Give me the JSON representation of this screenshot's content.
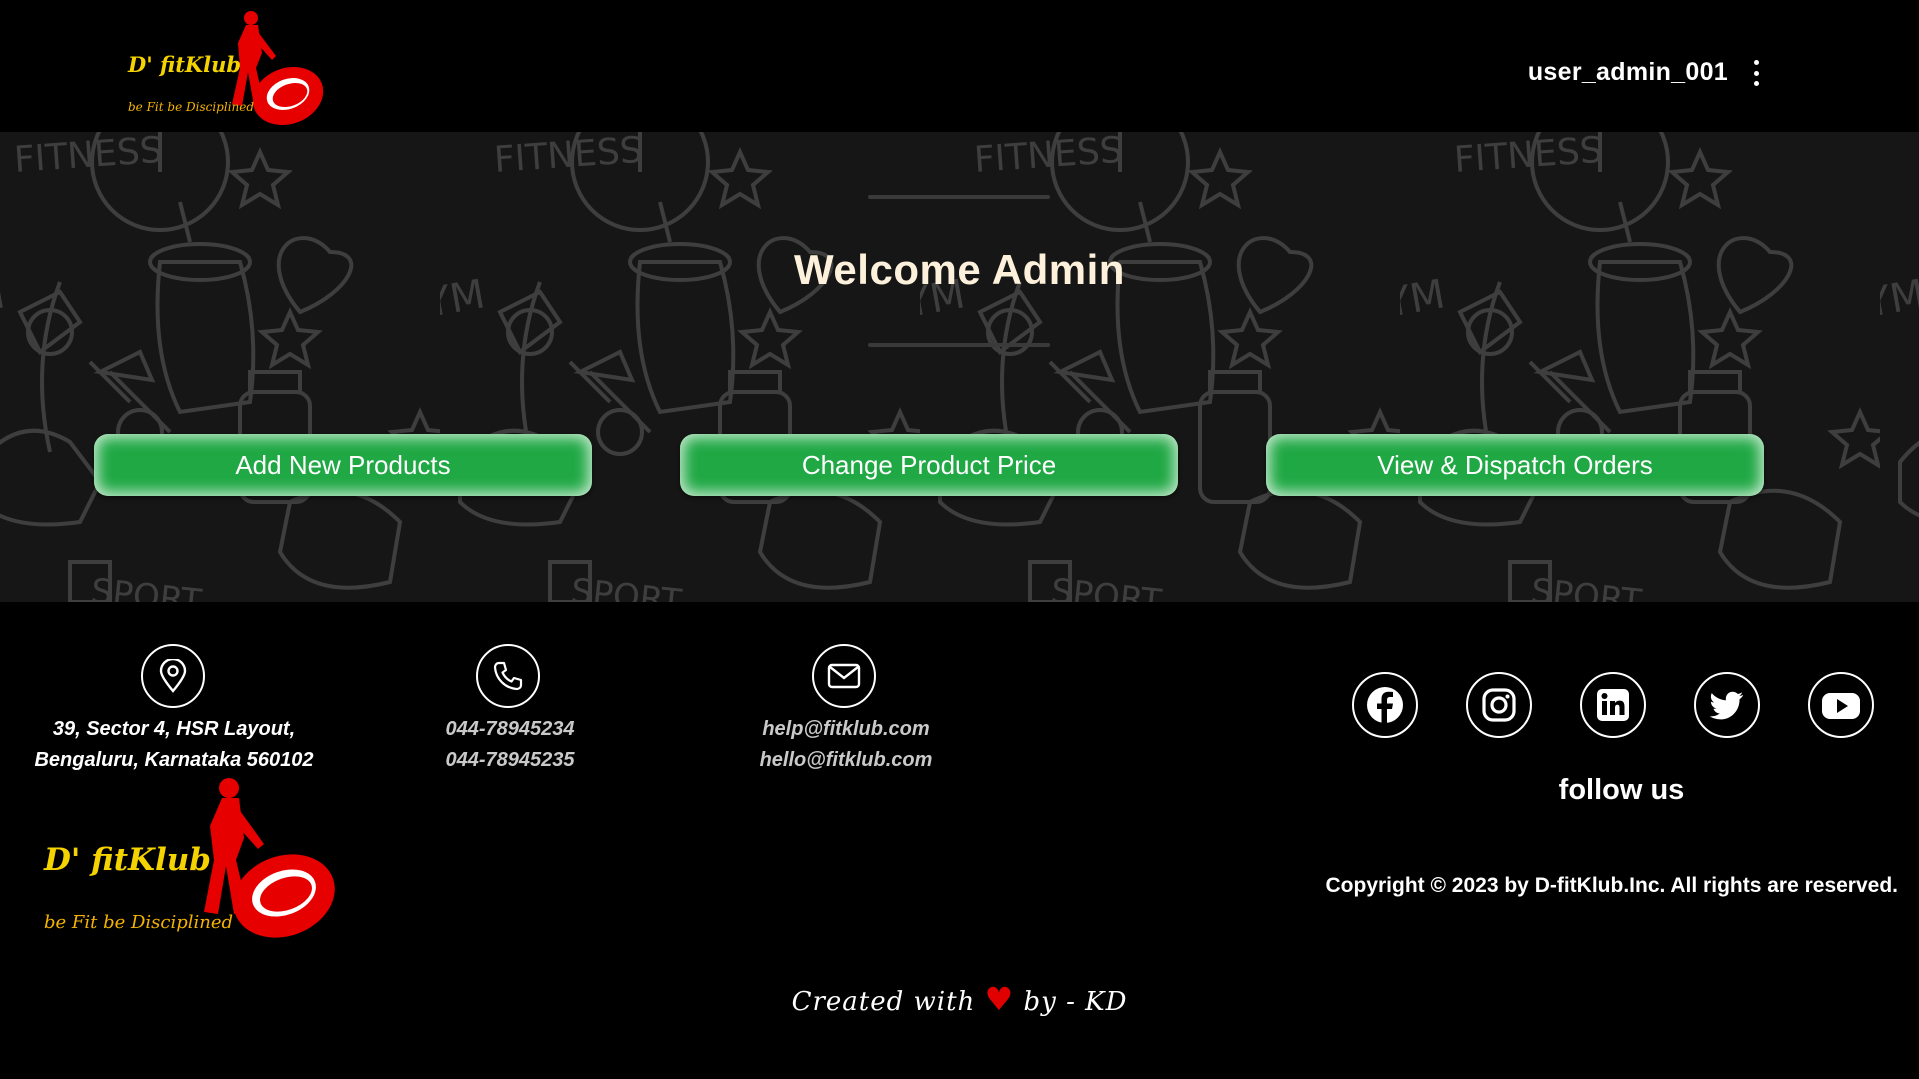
{
  "header": {
    "logo_name": "D' fitKlub",
    "logo_tagline": "be Fit be Disciplined",
    "username": "user_admin_001"
  },
  "hero": {
    "title": "Welcome Admin",
    "background_words": [
      "FITNESS",
      "GYM",
      "SPORT"
    ],
    "buttons": {
      "add_products": "Add New Products",
      "change_price": "Change Product Price",
      "dispatch_orders": "View & Dispatch Orders"
    }
  },
  "footer": {
    "address_line1": "39, Sector 4, HSR Layout,",
    "address_line2": "Bengaluru, Karnataka 560102",
    "phone1": "044-78945234",
    "phone2": "044-78945235",
    "email1": "help@fitklub.com",
    "email2": "hello@fitklub.com",
    "follow_label": "follow us",
    "social_icons": [
      "facebook-icon",
      "instagram-icon",
      "linkedin-icon",
      "twitter-icon",
      "youtube-icon"
    ],
    "copyright": "Copyright © 2023 by D-fitKlub.Inc. All rights are reserved.",
    "created_prefix": "Created with",
    "created_suffix": "by - KD"
  },
  "colors": {
    "accent_green": "#1fa844",
    "background": "#000000",
    "logo_red": "#e60000",
    "logo_yellow": "#f5d300",
    "title_cream": "#fdf1dc"
  }
}
